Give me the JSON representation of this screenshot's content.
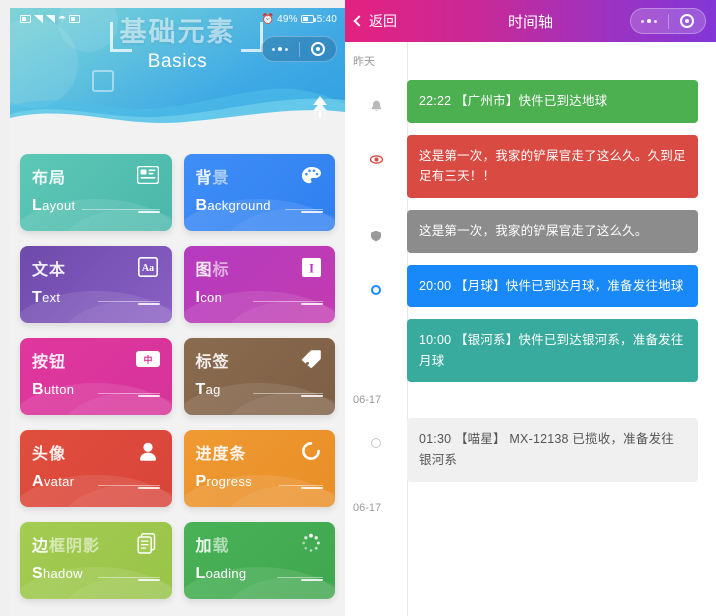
{
  "left": {
    "statusbar": {
      "battery_percent": "49%",
      "time": "5:40"
    },
    "banner": {
      "title_cn": "基础元素",
      "title_en": "Basics"
    },
    "capsule": {
      "more_icon": "more-dots-icon",
      "target_icon": "target-circle-icon"
    },
    "cards": [
      {
        "cn": "布局",
        "cn_dim": "",
        "en_initial": "L",
        "en_rest": "ayout",
        "icon": "layout-card-icon",
        "color_start": "#5ec8b6",
        "color_end": "#49b7aa",
        "rule_w": 78
      },
      {
        "cn": "背",
        "cn_dim": "景",
        "en_initial": "B",
        "en_rest": "ackground",
        "icon": "palette-icon",
        "color_start": "#3f8ef7",
        "color_end": "#2f7ff0",
        "rule_w": 38
      },
      {
        "cn": "文本",
        "cn_dim": "",
        "en_initial": "T",
        "en_rest": "ext",
        "icon": "text-aa-icon",
        "color_start": "#6d4bab",
        "color_end": "#8a5fc4",
        "rule_w": 62
      },
      {
        "cn": "图",
        "cn_dim": "标",
        "en_initial": "I",
        "en_rest": "con",
        "icon": "icon-badge-icon",
        "color_start": "#b43bbf",
        "color_end": "#c33bb0",
        "rule_w": 70
      },
      {
        "cn": "按钮",
        "cn_dim": "",
        "en_initial": "B",
        "en_rest": "utton",
        "icon": "button-cn-icon",
        "color_start": "#e0379e",
        "color_end": "#d6339a",
        "rule_w": 62
      },
      {
        "cn": "标签",
        "cn_dim": "",
        "en_initial": "T",
        "en_rest": "ag",
        "icon": "tag-icon",
        "color_start": "#8a6b4f",
        "color_end": "#7d5f45",
        "rule_w": 70
      },
      {
        "cn": "头像",
        "cn_dim": "",
        "en_initial": "A",
        "en_rest": "vatar",
        "icon": "person-icon",
        "color_start": "#e04e3c",
        "color_end": "#d9443a",
        "rule_w": 62
      },
      {
        "cn": "进度条",
        "cn_dim": "",
        "en_initial": "P",
        "en_rest": "rogress",
        "icon": "progress-spinner-icon",
        "color_start": "#ef9a32",
        "color_end": "#e98e27",
        "rule_w": 44
      },
      {
        "cn": "边",
        "cn_dim": "框阴影",
        "en_initial": "S",
        "en_rest": "hadow",
        "icon": "shadow-layers-icon",
        "color_start": "#a3cc52",
        "color_end": "#98c448",
        "rule_w": 62
      },
      {
        "cn": "加",
        "cn_dim": "载",
        "en_initial": "L",
        "en_rest": "oading",
        "icon": "loading-dots-icon",
        "color_start": "#49b257",
        "color_end": "#3fa74e",
        "rule_w": 46
      }
    ]
  },
  "right": {
    "header": {
      "back_label": "返回",
      "title": "时间轴"
    },
    "groups": [
      {
        "date": "昨天",
        "items": [
          {
            "marker": "bell-icon",
            "text": "22:22 【广州市】快件已到达地球",
            "bg": "#4caf50",
            "text_color": "#ffffff"
          },
          {
            "marker": "eye-red-icon",
            "text": "这是第一次，我家的铲屎官走了这么久。久到足足有三天！！",
            "bg": "#d84a42",
            "text_color": "#ffffff"
          },
          {
            "marker": "shield-gray-icon",
            "text": "这是第一次，我家的铲屎官走了这么久。",
            "bg": "#8c8c8c",
            "text_color": "#ffffff"
          },
          {
            "marker": "dot-blue-ring-icon",
            "text": "20:00 【月球】快件已到达月球，准备发往地球",
            "bg": "#1989fa",
            "text_color": "#ffffff"
          },
          {
            "marker": "none",
            "text": "10:00 【银河系】快件已到达银河系，准备发往月球",
            "bg": "#39ab9e",
            "text_color": "#ffffff"
          }
        ]
      },
      {
        "date": "06-17",
        "items": [
          {
            "marker": "dot-hollow-icon",
            "text": "01:30 【喵星】 MX-12138 已揽收，准备发往银河系",
            "bg": "#f0f0f0",
            "text_color": "#555555"
          }
        ]
      },
      {
        "date": "06-17",
        "items": []
      }
    ]
  }
}
